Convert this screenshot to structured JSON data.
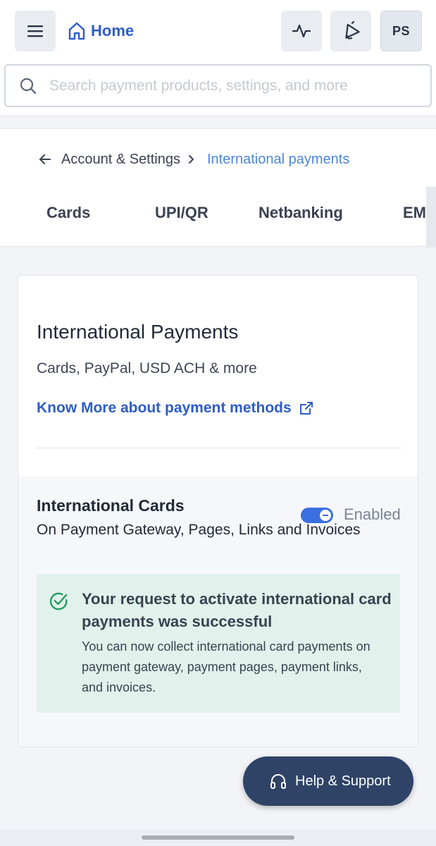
{
  "header": {
    "home_label": "Home",
    "avatar_initials": "PS",
    "search_placeholder": "Search payment products, settings, and more"
  },
  "breadcrumb": {
    "parent": "Account & Settings",
    "current": "International payments"
  },
  "tabs": [
    {
      "label": "Cards"
    },
    {
      "label": "UPI/QR"
    },
    {
      "label": "Netbanking"
    },
    {
      "label": "EMI"
    }
  ],
  "card": {
    "title": "International Payments",
    "subtitle": "Cards, PayPal, USD ACH & more",
    "know_more": "Know More about payment methods",
    "section": {
      "title": "International Cards",
      "subtitle": "On Payment Gateway, Pages, Links and Invoices",
      "toggle_on": true,
      "toggle_label": "Enabled"
    },
    "success": {
      "title": "Your request to activate international card payments was successful",
      "body": "You can now collect international card payments on payment gateway, payment pages, payment links, and invoices."
    }
  },
  "help": {
    "label": "Help & Support"
  },
  "colors": {
    "accent": "#2d5cc8",
    "breadcrumb_current": "#4f86d9",
    "toggle": "#3b6fe0",
    "success_bg": "#e0f2eb",
    "success_icon": "#1f9a5c",
    "help_bg": "#2e4366"
  }
}
